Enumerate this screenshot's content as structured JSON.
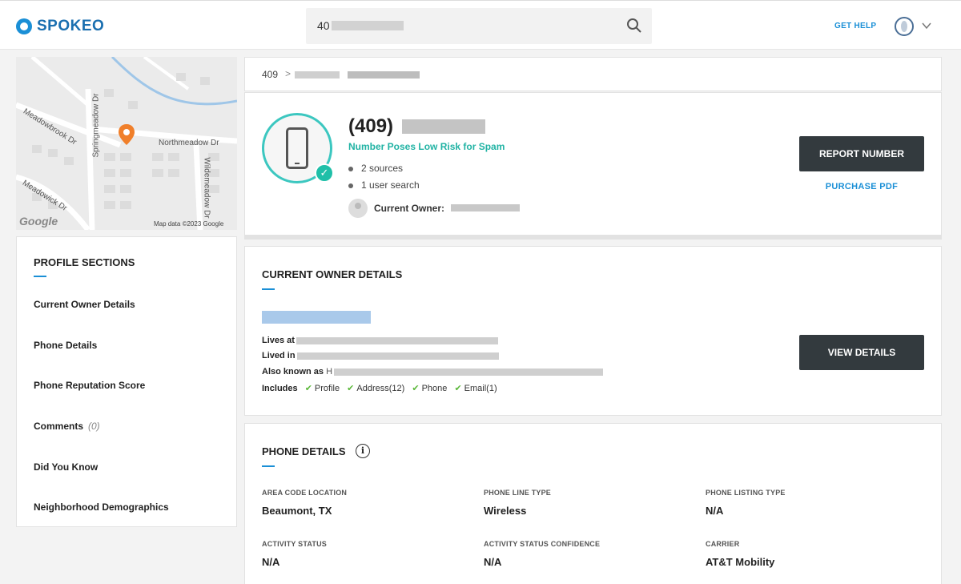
{
  "header": {
    "logo_text": "SPOKEO",
    "search_value": "40",
    "get_help": "GET HELP"
  },
  "map": {
    "streets": [
      "Meadowbrook Dr",
      "Springmeadow Dr",
      "Northmeadow Dr",
      "Wildemeadow Dr",
      "Meadowick Dr"
    ],
    "google_logo": "Google",
    "credit": "Map data ©2023 Google"
  },
  "sidebar": {
    "title": "PROFILE SECTIONS",
    "items": [
      {
        "label": "Current Owner Details"
      },
      {
        "label": "Phone Details"
      },
      {
        "label": "Phone Reputation Score"
      },
      {
        "label": "Comments",
        "count": "(0)"
      },
      {
        "label": "Did You Know"
      },
      {
        "label": "Neighborhood Demographics"
      }
    ]
  },
  "breadcrumb": {
    "root": "409",
    "separator": ">"
  },
  "summary": {
    "phone_prefix": "(409)",
    "spam_risk": "Number Poses Low Risk for Spam",
    "sources": "2 sources",
    "user_search": "1 user search",
    "current_owner_label": "Current Owner:",
    "report_button": "REPORT NUMBER",
    "purchase_link": "PURCHASE PDF"
  },
  "owner_details": {
    "title": "CURRENT OWNER DETAILS",
    "lives_at": "Lives at",
    "lived_in": "Lived in",
    "also_known_as": "Also known as",
    "aka_initial": "H",
    "includes_label": "Includes",
    "includes": [
      "Profile",
      "Address(12)",
      "Phone",
      "Email(1)"
    ],
    "view_button": "VIEW DETAILS"
  },
  "phone_details": {
    "title": "PHONE DETAILS",
    "fields": [
      {
        "label": "AREA CODE LOCATION",
        "value": "Beaumont, TX"
      },
      {
        "label": "PHONE LINE TYPE",
        "value": "Wireless"
      },
      {
        "label": "PHONE LISTING TYPE",
        "value": "N/A"
      },
      {
        "label": "ACTIVITY STATUS",
        "value": "N/A"
      },
      {
        "label": "ACTIVITY STATUS CONFIDENCE",
        "value": "N/A"
      },
      {
        "label": "CARRIER",
        "value": "AT&T Mobility"
      }
    ]
  },
  "colors": {
    "accent_blue": "#1a8fd6",
    "teal": "#21b3a4",
    "dark_button": "#333a3e",
    "check_green": "#5bb83a"
  }
}
